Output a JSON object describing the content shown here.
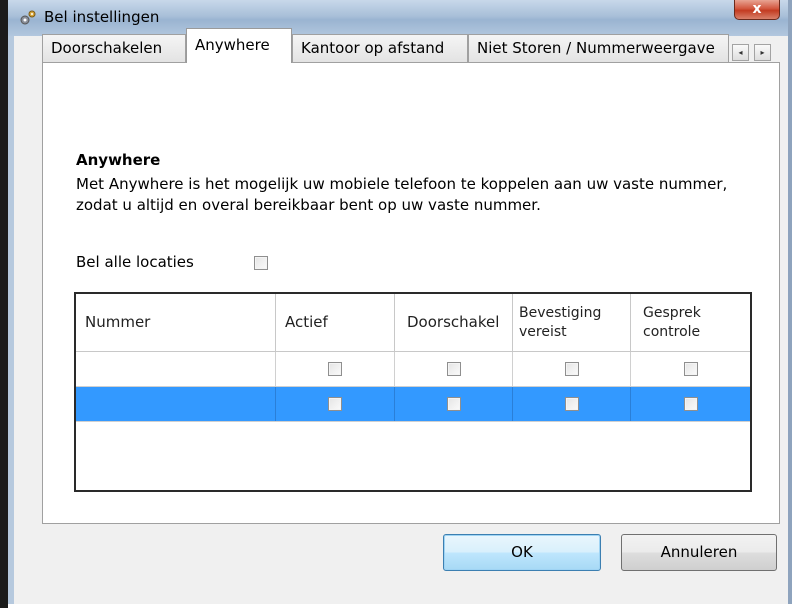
{
  "window": {
    "title": "Bel instellingen",
    "close_label": "x"
  },
  "tabs": [
    {
      "label": "Doorschakelen",
      "active": false
    },
    {
      "label": "Anywhere",
      "active": true
    },
    {
      "label": "Kantoor op afstand",
      "active": false
    },
    {
      "label": "Niet Storen / Nummerweergave",
      "active": false
    }
  ],
  "tab_scroll": {
    "left": "◂",
    "right": "▸"
  },
  "section": {
    "title": "Anywhere",
    "description": "Met Anywhere is het mogelijk uw mobiele telefoon te koppelen aan uw vaste nummer, zodat u altijd en overal bereikbaar bent op uw vaste nummer."
  },
  "bel_alle": {
    "label": "Bel alle locaties",
    "checked": false
  },
  "grid": {
    "columns": [
      "Nummer",
      "Actief",
      "Doorschakel",
      "Bevestiging vereist",
      "Gesprek controle"
    ],
    "rows": [
      {
        "nummer": "",
        "selected": false
      },
      {
        "nummer": "",
        "selected": true
      }
    ]
  },
  "buttons": {
    "ok": "OK",
    "cancel": "Annuleren"
  },
  "colors": {
    "selection": "#3399ff",
    "titlebar": "#a8bfd8",
    "close": "#c33b21"
  }
}
